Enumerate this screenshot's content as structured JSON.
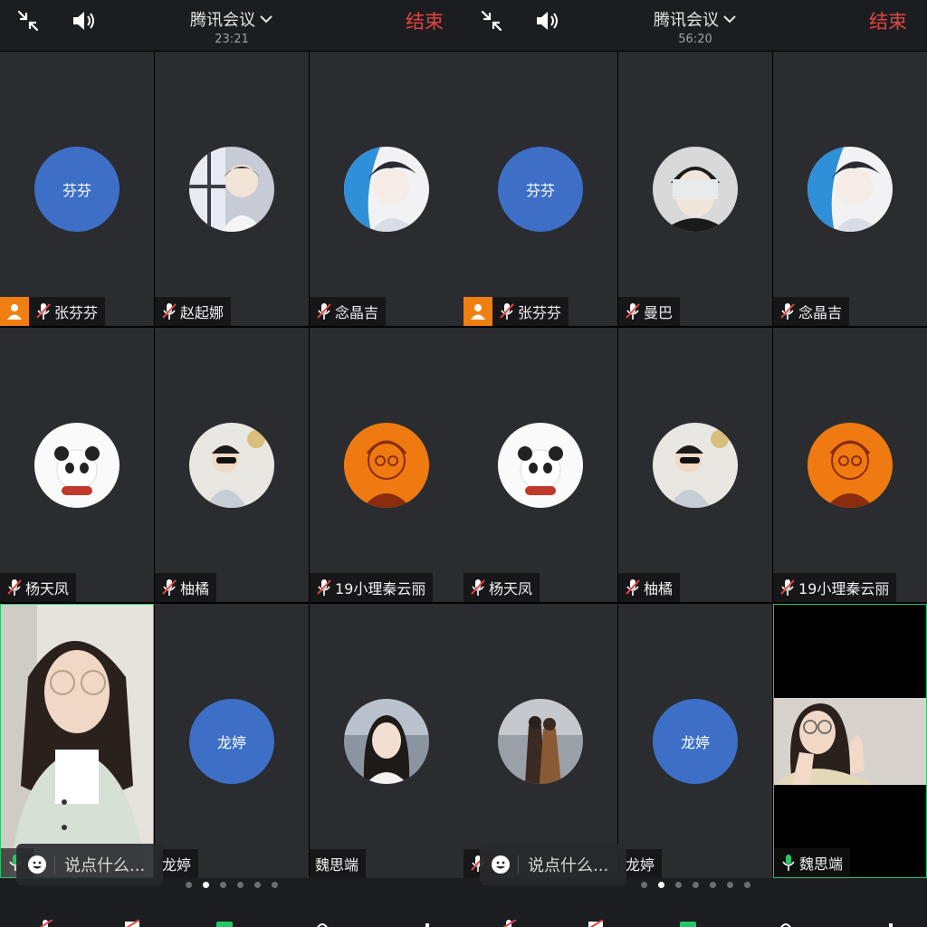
{
  "panels": [
    {
      "header": {
        "title": "腾讯会议",
        "time": "23:21",
        "end_label": "结束"
      },
      "tiles": [
        {
          "name": "张芬芬",
          "avatar_text": "芬芬",
          "avatar_type": "text",
          "host": true,
          "mic": "muted"
        },
        {
          "name": "赵起娜",
          "avatar_type": "photo",
          "avatar_desc": "anime-boy-window",
          "mic": "muted"
        },
        {
          "name": "念晶吉",
          "avatar_type": "photo",
          "avatar_desc": "anime-blue-hair",
          "mic": "muted"
        },
        {
          "name": "杨天凤",
          "avatar_type": "photo",
          "avatar_desc": "panda",
          "mic": "muted"
        },
        {
          "name": "柚橘",
          "avatar_type": "photo",
          "avatar_desc": "kid-sunglasses",
          "mic": "muted"
        },
        {
          "name": "19小理秦云丽",
          "avatar_type": "photo",
          "avatar_desc": "orange-sketch",
          "mic": "muted"
        },
        {
          "name": "",
          "avatar_type": "video",
          "mic": "active"
        },
        {
          "name": "龙婷",
          "avatar_text": "龙婷",
          "avatar_type": "text",
          "mic": "none"
        },
        {
          "name": "魏思端",
          "avatar_type": "photo",
          "avatar_desc": "girl-portrait",
          "mic": "none"
        }
      ],
      "chat_placeholder": "说点什么...",
      "page_dots": {
        "count": 6,
        "active": 1
      }
    },
    {
      "header": {
        "title": "腾讯会议",
        "time": "56:20",
        "end_label": "结束"
      },
      "tiles": [
        {
          "name": "张芬芬",
          "avatar_text": "芬芬",
          "avatar_type": "text",
          "host": true,
          "mic": "muted"
        },
        {
          "name": "曼巴",
          "avatar_type": "photo",
          "avatar_desc": "masked-face",
          "mic": "muted"
        },
        {
          "name": "念晶吉",
          "avatar_type": "photo",
          "avatar_desc": "anime-blue-hair",
          "mic": "muted"
        },
        {
          "name": "杨天凤",
          "avatar_type": "photo",
          "avatar_desc": "panda",
          "mic": "muted"
        },
        {
          "name": "柚橘",
          "avatar_type": "photo",
          "avatar_desc": "kid-sunglasses",
          "mic": "muted"
        },
        {
          "name": "19小理秦云丽",
          "avatar_type": "photo",
          "avatar_desc": "orange-sketch",
          "mic": "muted"
        },
        {
          "name": "",
          "avatar_type": "photo",
          "avatar_desc": "couple-street",
          "mic": "muted"
        },
        {
          "name": "龙婷",
          "avatar_text": "龙婷",
          "avatar_type": "text",
          "mic": "none"
        },
        {
          "name": "魏思端",
          "avatar_type": "video",
          "mic": "active"
        }
      ],
      "chat_placeholder": "说点什么...",
      "page_dots": {
        "count": 7,
        "active": 1
      }
    }
  ],
  "colors": {
    "end": "#e5443f",
    "host": "#f07f12",
    "text_avatar": "#3d6fc7",
    "active_border": "#27c46a",
    "tile_bg": "#2b2c30"
  }
}
